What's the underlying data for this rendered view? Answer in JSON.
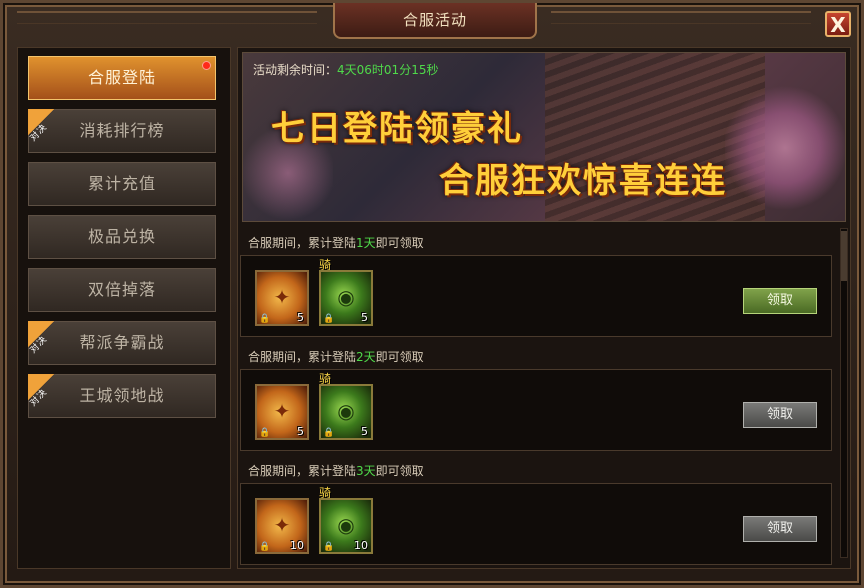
{
  "window": {
    "title": "合服活动",
    "close_label": "X"
  },
  "sidebar": {
    "items": [
      {
        "label": "合服登陆",
        "active": true,
        "ribbon": "",
        "dot": true
      },
      {
        "label": "消耗排行榜",
        "active": false,
        "ribbon": "对决"
      },
      {
        "label": "累计充值",
        "active": false,
        "ribbon": ""
      },
      {
        "label": "极品兑换",
        "active": false,
        "ribbon": ""
      },
      {
        "label": "双倍掉落",
        "active": false,
        "ribbon": ""
      },
      {
        "label": "帮派争霸战",
        "active": false,
        "ribbon": "对决"
      },
      {
        "label": "王城领地战",
        "active": false,
        "ribbon": "对决"
      }
    ]
  },
  "banner": {
    "timer_label": "活动剩余时间：",
    "timer_value": "4天06时01分15秒",
    "slogan_line1": "七日登陆领豪礼",
    "slogan_line2": "合服狂欢惊喜连连"
  },
  "rewards": [
    {
      "prefix": "合服期间，累计登陆",
      "days": "1天",
      "suffix": "即可领取",
      "items": [
        {
          "icon": "scroll-icon",
          "count": "5"
        },
        {
          "icon": "mount-orb-icon",
          "count": "5",
          "tag": "骑"
        }
      ],
      "button_label": "领取",
      "button_state": "enabled"
    },
    {
      "prefix": "合服期间，累计登陆",
      "days": "2天",
      "suffix": "即可领取",
      "items": [
        {
          "icon": "scroll-icon",
          "count": "5"
        },
        {
          "icon": "mount-orb-icon",
          "count": "5",
          "tag": "骑"
        }
      ],
      "button_label": "领取",
      "button_state": "disabled"
    },
    {
      "prefix": "合服期间，累计登陆",
      "days": "3天",
      "suffix": "即可领取",
      "items": [
        {
          "icon": "scroll-icon",
          "count": "10"
        },
        {
          "icon": "mount-orb-icon",
          "count": "10",
          "tag": "骑"
        }
      ],
      "button_label": "领取",
      "button_state": "disabled"
    }
  ],
  "colors": {
    "accent_orange": "#e0922e",
    "timer_green": "#4fd94a",
    "slogan_gold": "#ffcf3a"
  }
}
